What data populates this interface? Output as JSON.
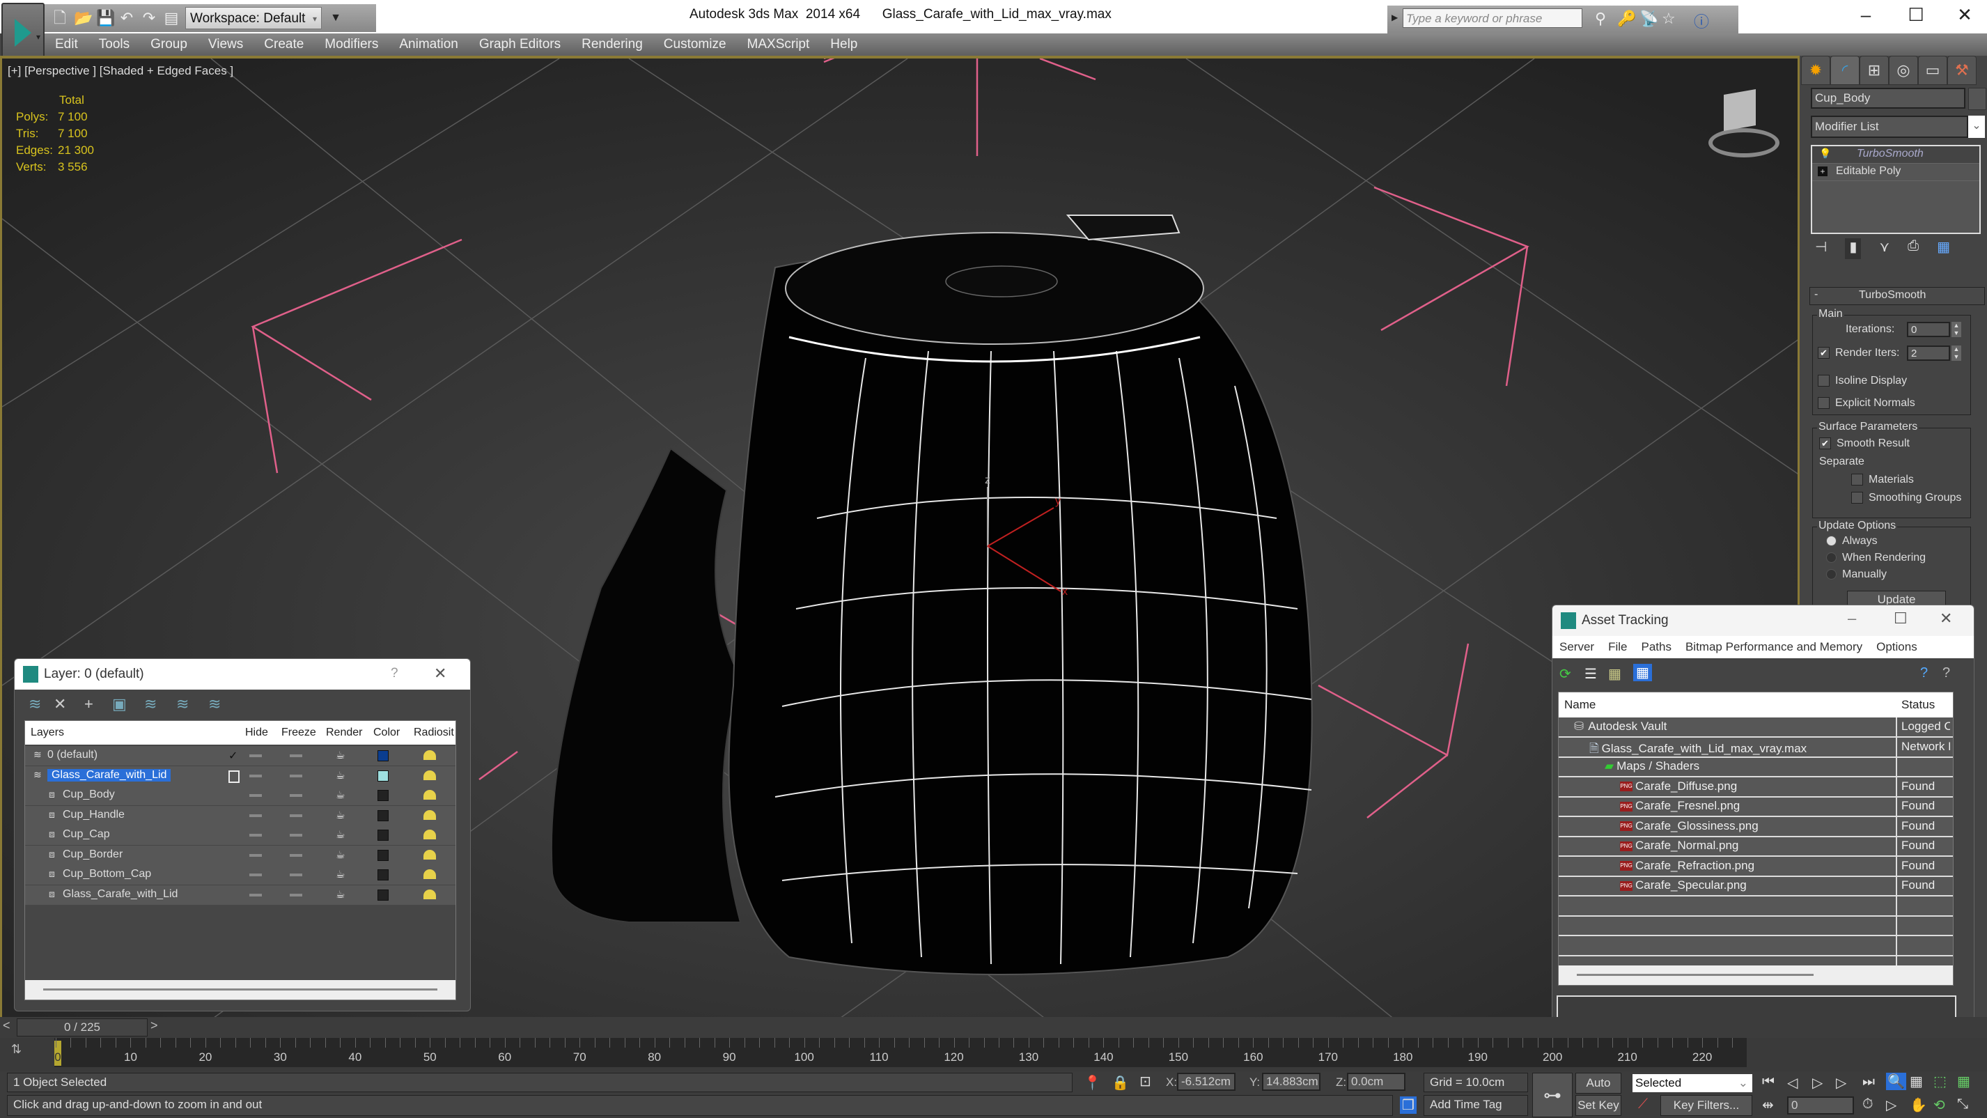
{
  "titlebar": {
    "app_title": "Autodesk 3ds Max  2014 x64",
    "file_name": "Glass_Carafe_with_Lid_max_vray.max",
    "workspace": "Workspace: Default",
    "search_placeholder": "Type a keyword or phrase"
  },
  "menu": [
    "Edit",
    "Tools",
    "Group",
    "Views",
    "Create",
    "Modifiers",
    "Animation",
    "Graph Editors",
    "Rendering",
    "Customize",
    "MAXScript",
    "Help"
  ],
  "viewport": {
    "label": "[+] [Perspective ] [Shaded + Edged Faces ]",
    "stats": {
      "header": "Total",
      "rows": [
        {
          "k": "Polys:",
          "v": "7 100"
        },
        {
          "k": "Tris:",
          "v": "7 100"
        },
        {
          "k": "Edges:",
          "v": "21 300"
        },
        {
          "k": "Verts:",
          "v": "3 556"
        }
      ]
    },
    "axis_labels": {
      "x": "x",
      "y": "y",
      "z": "z"
    }
  },
  "command_panel": {
    "object_name": "Cup_Body",
    "modifier_list": "Modifier List",
    "stack": [
      "TurboSmooth",
      "Editable Poly"
    ],
    "rollout_title": "TurboSmooth",
    "main_group": "Main",
    "iterations_label": "Iterations:",
    "iterations_value": "0",
    "render_iters_label": "Render Iters:",
    "render_iters_value": "2",
    "render_iters_checked": true,
    "isoline_label": "Isoline Display",
    "explicit_normals_label": "Explicit Normals",
    "surface_group": "Surface Parameters",
    "smooth_result_label": "Smooth Result",
    "separate_label": "Separate",
    "materials_label": "Materials",
    "smoothing_groups_label": "Smoothing Groups",
    "update_group": "Update Options",
    "update_options": [
      "Always",
      "When Rendering",
      "Manually"
    ],
    "update_selected": "Always",
    "update_button": "Update"
  },
  "layer_dialog": {
    "title": "Layer: 0 (default)",
    "help": "?",
    "columns": [
      "Layers",
      "Hide",
      "Freeze",
      "Render",
      "Color",
      "Radiosit"
    ],
    "rows": [
      {
        "name": "0 (default)",
        "type": "layer",
        "current": true,
        "color": "#0a3d8f"
      },
      {
        "name": "Glass_Carafe_with_Lid",
        "type": "layer",
        "selected": true,
        "color": "#9fe0e0"
      },
      {
        "name": "Cup_Body",
        "type": "object",
        "color": "#222222"
      },
      {
        "name": "Cup_Handle",
        "type": "object",
        "color": "#222222"
      },
      {
        "name": "Cup_Cap",
        "type": "object",
        "color": "#222222"
      },
      {
        "name": "Cup_Border",
        "type": "object",
        "color": "#222222"
      },
      {
        "name": "Cup_Bottom_Cap",
        "type": "object",
        "color": "#222222"
      },
      {
        "name": "Glass_Carafe_with_Lid",
        "type": "object",
        "color": "#222222"
      }
    ]
  },
  "asset_dialog": {
    "title": "Asset Tracking",
    "menu": [
      "Server",
      "File",
      "Paths",
      "Bitmap Performance and Memory",
      "Options"
    ],
    "columns": [
      "Name",
      "Status"
    ],
    "rows": [
      {
        "name": "Autodesk Vault",
        "status": "Logged Ou",
        "level": 0,
        "icon": "vault"
      },
      {
        "name": "Glass_Carafe_with_Lid_max_vray.max",
        "status": "Network Pa",
        "level": 1,
        "icon": "max"
      },
      {
        "name": "Maps / Shaders",
        "status": "",
        "level": 2,
        "icon": "maps"
      },
      {
        "name": "Carafe_Diffuse.png",
        "status": "Found",
        "level": 3,
        "icon": "png"
      },
      {
        "name": "Carafe_Fresnel.png",
        "status": "Found",
        "level": 3,
        "icon": "png"
      },
      {
        "name": "Carafe_Glossiness.png",
        "status": "Found",
        "level": 3,
        "icon": "png"
      },
      {
        "name": "Carafe_Normal.png",
        "status": "Found",
        "level": 3,
        "icon": "png"
      },
      {
        "name": "Carafe_Refraction.png",
        "status": "Found",
        "level": 3,
        "icon": "png"
      },
      {
        "name": "Carafe_Specular.png",
        "status": "Found",
        "level": 3,
        "icon": "png"
      }
    ]
  },
  "timeline": {
    "frame_display": "0 / 225",
    "current_frame": 0,
    "total_frames": 225,
    "ticks": [
      "10",
      "20",
      "30",
      "40",
      "50",
      "60",
      "70",
      "80",
      "90",
      "100",
      "110",
      "120",
      "130",
      "140",
      "150",
      "160",
      "170",
      "180",
      "190",
      "200",
      "210",
      "220"
    ]
  },
  "status": {
    "selection": "1 Object Selected",
    "prompt": "Click and drag up-and-down to zoom in and out",
    "x_label": "X:",
    "x": "-6.512cm",
    "y_label": "Y:",
    "y": "14.883cm",
    "z_label": "Z:",
    "z": "0.0cm",
    "grid": "Grid = 10.0cm",
    "add_time_tag": "Add Time Tag",
    "auto_key": "Auto Key",
    "set_key": "Set Key",
    "key_mode": "Selected",
    "key_filters": "Key Filters...",
    "frame_field": "0"
  }
}
